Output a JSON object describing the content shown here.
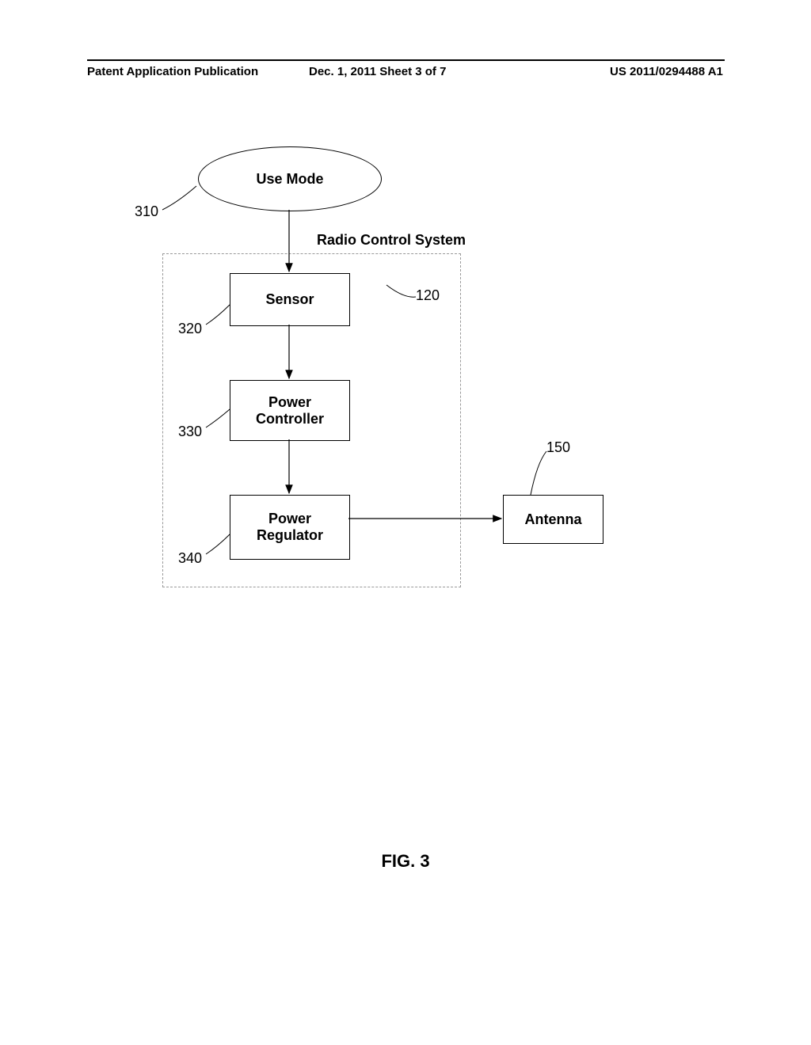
{
  "header": {
    "left": "Patent Application Publication",
    "center": "Dec. 1, 2011  Sheet 3 of 7",
    "right": "US 2011/0294488 A1"
  },
  "blocks": {
    "use_mode": "Use Mode",
    "sensor": "Sensor",
    "power_controller": "Power\nController",
    "power_regulator": "Power\nRegulator",
    "antenna": "Antenna",
    "system_label": "Radio Control System"
  },
  "refs": {
    "r310": "310",
    "r120": "120",
    "r320": "320",
    "r330": "330",
    "r340": "340",
    "r150": "150"
  },
  "figure": "FIG. 3"
}
